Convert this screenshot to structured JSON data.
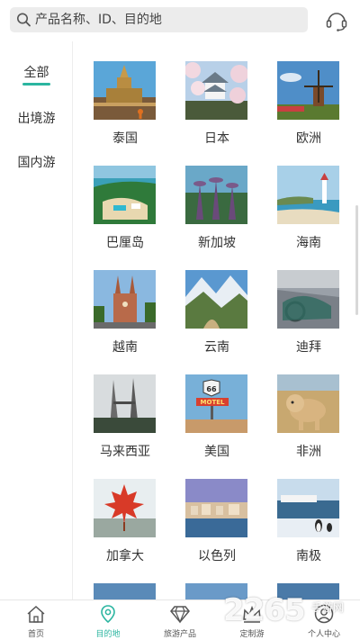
{
  "search": {
    "placeholder": "产品名称、ID、目的地"
  },
  "categories": [
    {
      "label": "全部"
    },
    {
      "label": "出境游"
    },
    {
      "label": "国内游"
    }
  ],
  "destinations": [
    {
      "label": "泰国"
    },
    {
      "label": "日本"
    },
    {
      "label": "欧洲"
    },
    {
      "label": "巴厘岛"
    },
    {
      "label": "新加坡"
    },
    {
      "label": "海南"
    },
    {
      "label": "越南"
    },
    {
      "label": "云南"
    },
    {
      "label": "迪拜"
    },
    {
      "label": "马来西亚"
    },
    {
      "label": "美国"
    },
    {
      "label": "非洲"
    },
    {
      "label": "加拿大"
    },
    {
      "label": "以色列"
    },
    {
      "label": "南极"
    }
  ],
  "motel_sign": "MOTEL",
  "route_sign": "66",
  "bottom_nav": [
    {
      "label": "首页"
    },
    {
      "label": "目的地"
    },
    {
      "label": "旅游产品"
    },
    {
      "label": "定制游"
    },
    {
      "label": "个人中心"
    }
  ],
  "watermark": {
    "big": "2265",
    "small": "手游网"
  },
  "colors": {
    "accent": "#2bb5a0",
    "search_bg": "#ececec"
  }
}
